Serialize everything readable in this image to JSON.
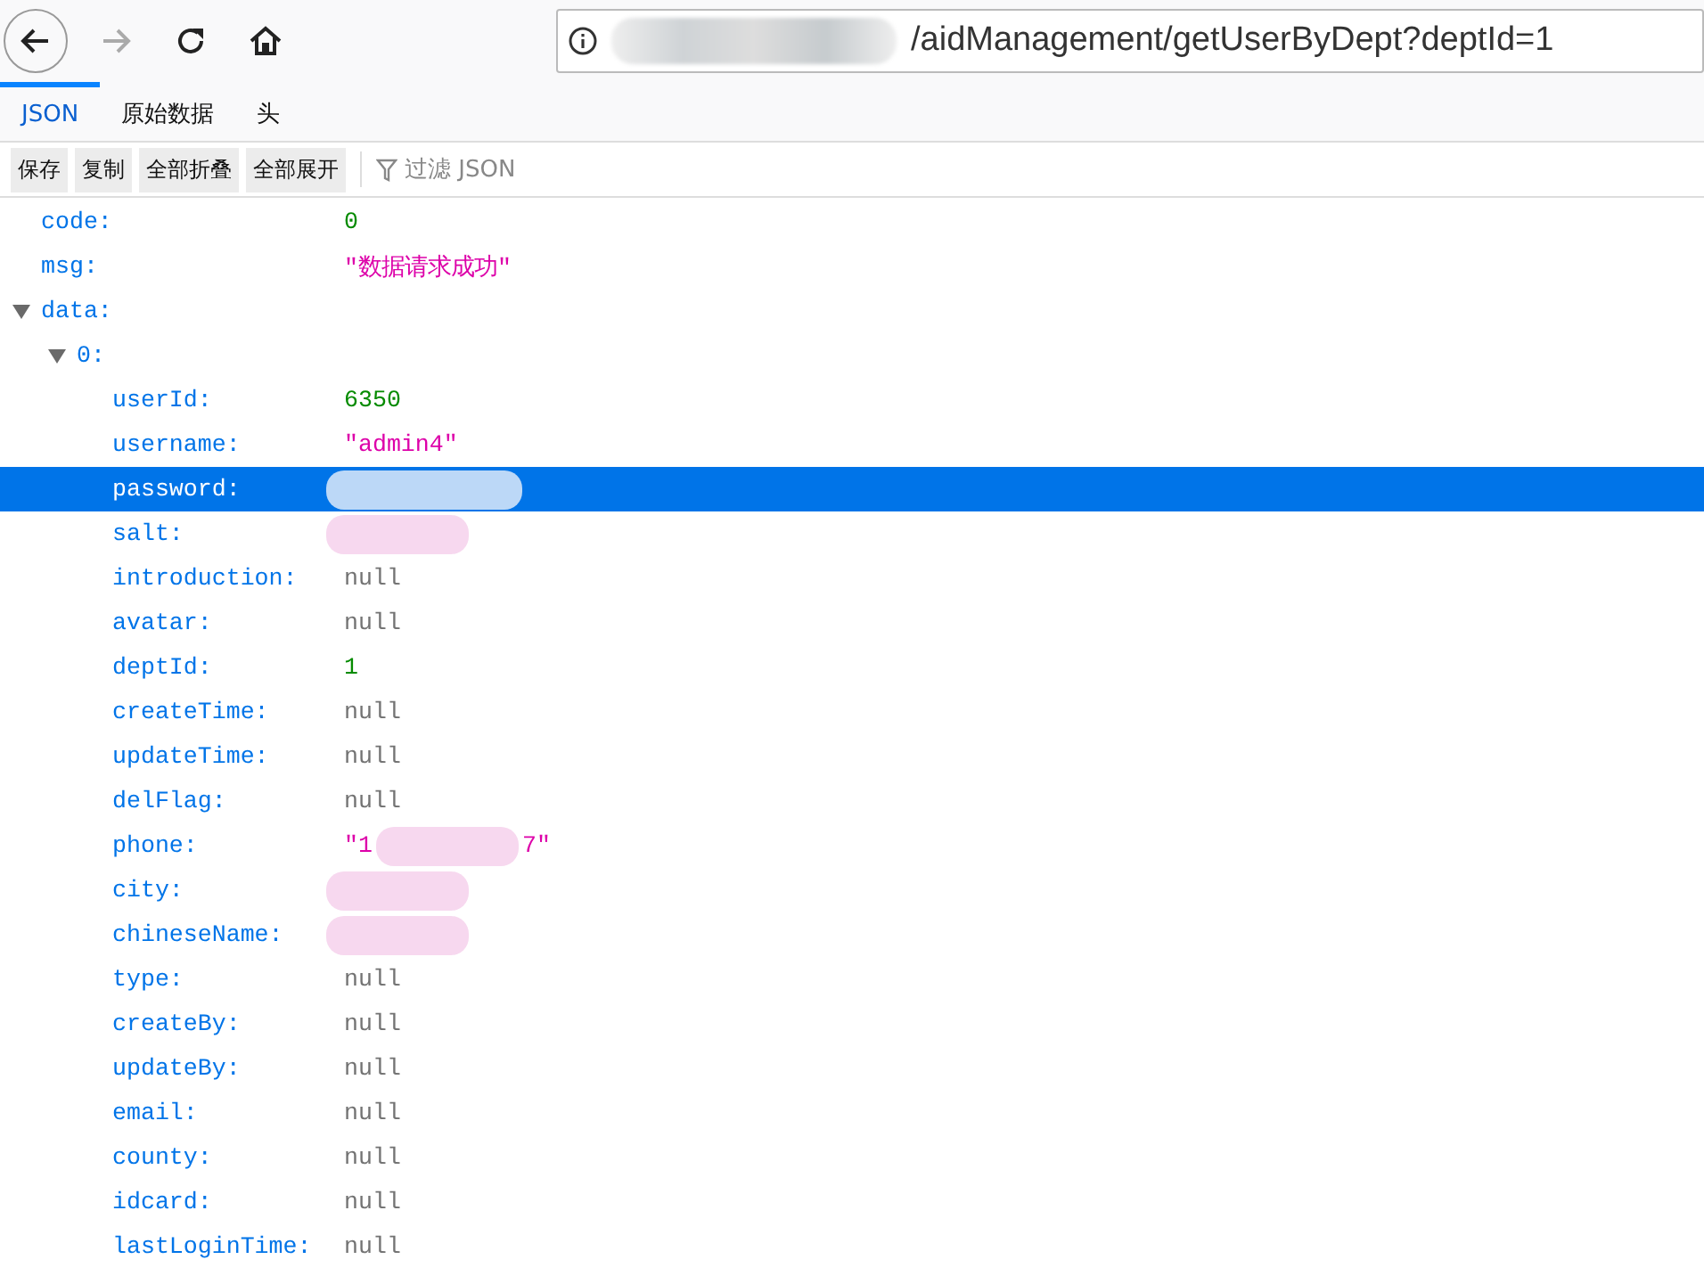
{
  "nav": {
    "back_disabled": false,
    "forward_disabled": true
  },
  "address": {
    "url": "/aidManagement/getUserByDept?deptId=1",
    "host_redacted": true
  },
  "tabs": [
    {
      "label": "JSON",
      "selected": true
    },
    {
      "label": "原始数据",
      "selected": false
    },
    {
      "label": "头",
      "selected": false
    }
  ],
  "toolbar": {
    "buttons": [
      "保存",
      "复制",
      "全部折叠",
      "全部展开"
    ],
    "filter": {
      "placeholder": "过滤 JSON"
    }
  },
  "rows": [
    {
      "key": "code:",
      "value": "0",
      "kind": "number",
      "selected": false
    },
    {
      "key": "msg:",
      "value": "\"数据请求成功\"",
      "kind": "string",
      "selected": false
    },
    {
      "key": "data:",
      "selected": false,
      "expanded": true,
      "children": [
        {
          "key": "0:",
          "selected": false,
          "expanded": true,
          "children": [
            {
              "key": "userId:",
              "value": "6350",
              "kind": "number",
              "selected": false
            },
            {
              "key": "username:",
              "value": "\"admin4\"",
              "kind": "string",
              "selected": false
            },
            {
              "key": "password:",
              "selected": true,
              "redacted": true
            },
            {
              "key": "salt:",
              "selected": false,
              "redacted": true
            },
            {
              "key": "introduction:",
              "value": "null",
              "kind": "null",
              "selected": false
            },
            {
              "key": "avatar:",
              "value": "null",
              "kind": "null",
              "selected": false
            },
            {
              "key": "deptId:",
              "value": "1",
              "kind": "number",
              "selected": false
            },
            {
              "key": "createTime:",
              "value": "null",
              "kind": "null",
              "selected": false
            },
            {
              "key": "updateTime:",
              "value": "null",
              "kind": "null",
              "selected": false
            },
            {
              "key": "delFlag:",
              "value": "null",
              "kind": "null",
              "selected": false
            },
            {
              "key": "phone:",
              "value": "\"1",
              "value_tail": "7\"",
              "kind": "string",
              "selected": false,
              "redacted": true
            },
            {
              "key": "city:",
              "selected": false,
              "redacted": true
            },
            {
              "key": "chineseName:",
              "selected": false,
              "redacted": true
            },
            {
              "key": "type:",
              "value": "null",
              "kind": "null",
              "selected": false
            },
            {
              "key": "createBy:",
              "value": "null",
              "kind": "null",
              "selected": false
            },
            {
              "key": "updateBy:",
              "value": "null",
              "kind": "null",
              "selected": false
            },
            {
              "key": "email:",
              "value": "null",
              "kind": "null",
              "selected": false
            },
            {
              "key": "county:",
              "value": "null",
              "kind": "null",
              "selected": false
            },
            {
              "key": "idcard:",
              "value": "null",
              "kind": "null",
              "selected": false
            },
            {
              "key": "lastLoginTime:",
              "value": "null",
              "kind": "null",
              "selected": false
            }
          ]
        }
      ]
    }
  ]
}
